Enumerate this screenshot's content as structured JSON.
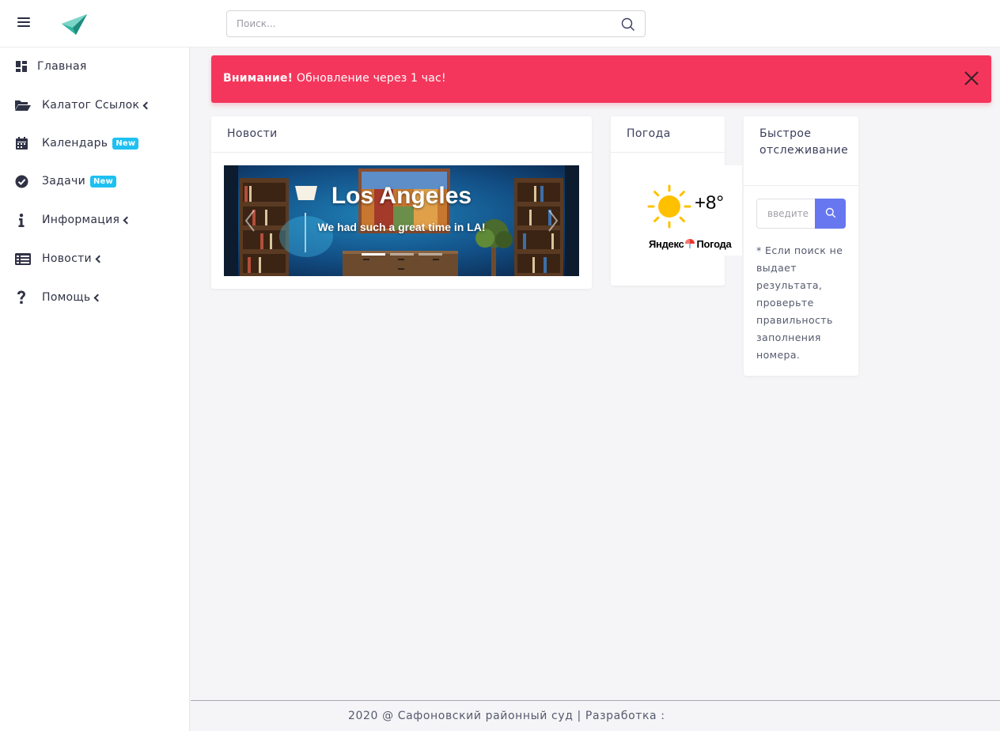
{
  "header": {
    "search_placeholder": "Поиск..."
  },
  "sidebar": {
    "items": [
      {
        "label": "Главная",
        "icon": "dashboard-icon"
      },
      {
        "label": "Калатог Ссылок",
        "icon": "folder-open-icon"
      },
      {
        "label": "Календарь",
        "icon": "calendar-icon",
        "badge": "New"
      },
      {
        "label": "Задачи",
        "icon": "check-circle-icon",
        "badge": "New"
      },
      {
        "label": "Информация",
        "icon": "info-icon"
      },
      {
        "label": "Новости",
        "icon": "newspaper-icon"
      },
      {
        "label": "Помощь",
        "icon": "question-icon"
      }
    ]
  },
  "alert": {
    "strong": "Внимание!",
    "text": " Обновление через 1 час!",
    "color": "#f5365c"
  },
  "news": {
    "title": "Новости",
    "carousel": {
      "slide_title": "Los Angeles",
      "slide_caption": "We had such a great time in LA!"
    }
  },
  "weather": {
    "title": "Погода",
    "temperature": "+8°",
    "provider": "Яндекс",
    "provider_service": "Погода"
  },
  "tracking": {
    "title": "Быстрое отслеживание",
    "input_placeholder": "введите",
    "note": "* Если поиск не выдает результата, проверьте правильность заполнения номера.",
    "button_color": "#6777ef"
  },
  "footer": {
    "text": "2020 @ Сафоновский районный суд | Разработка :"
  }
}
